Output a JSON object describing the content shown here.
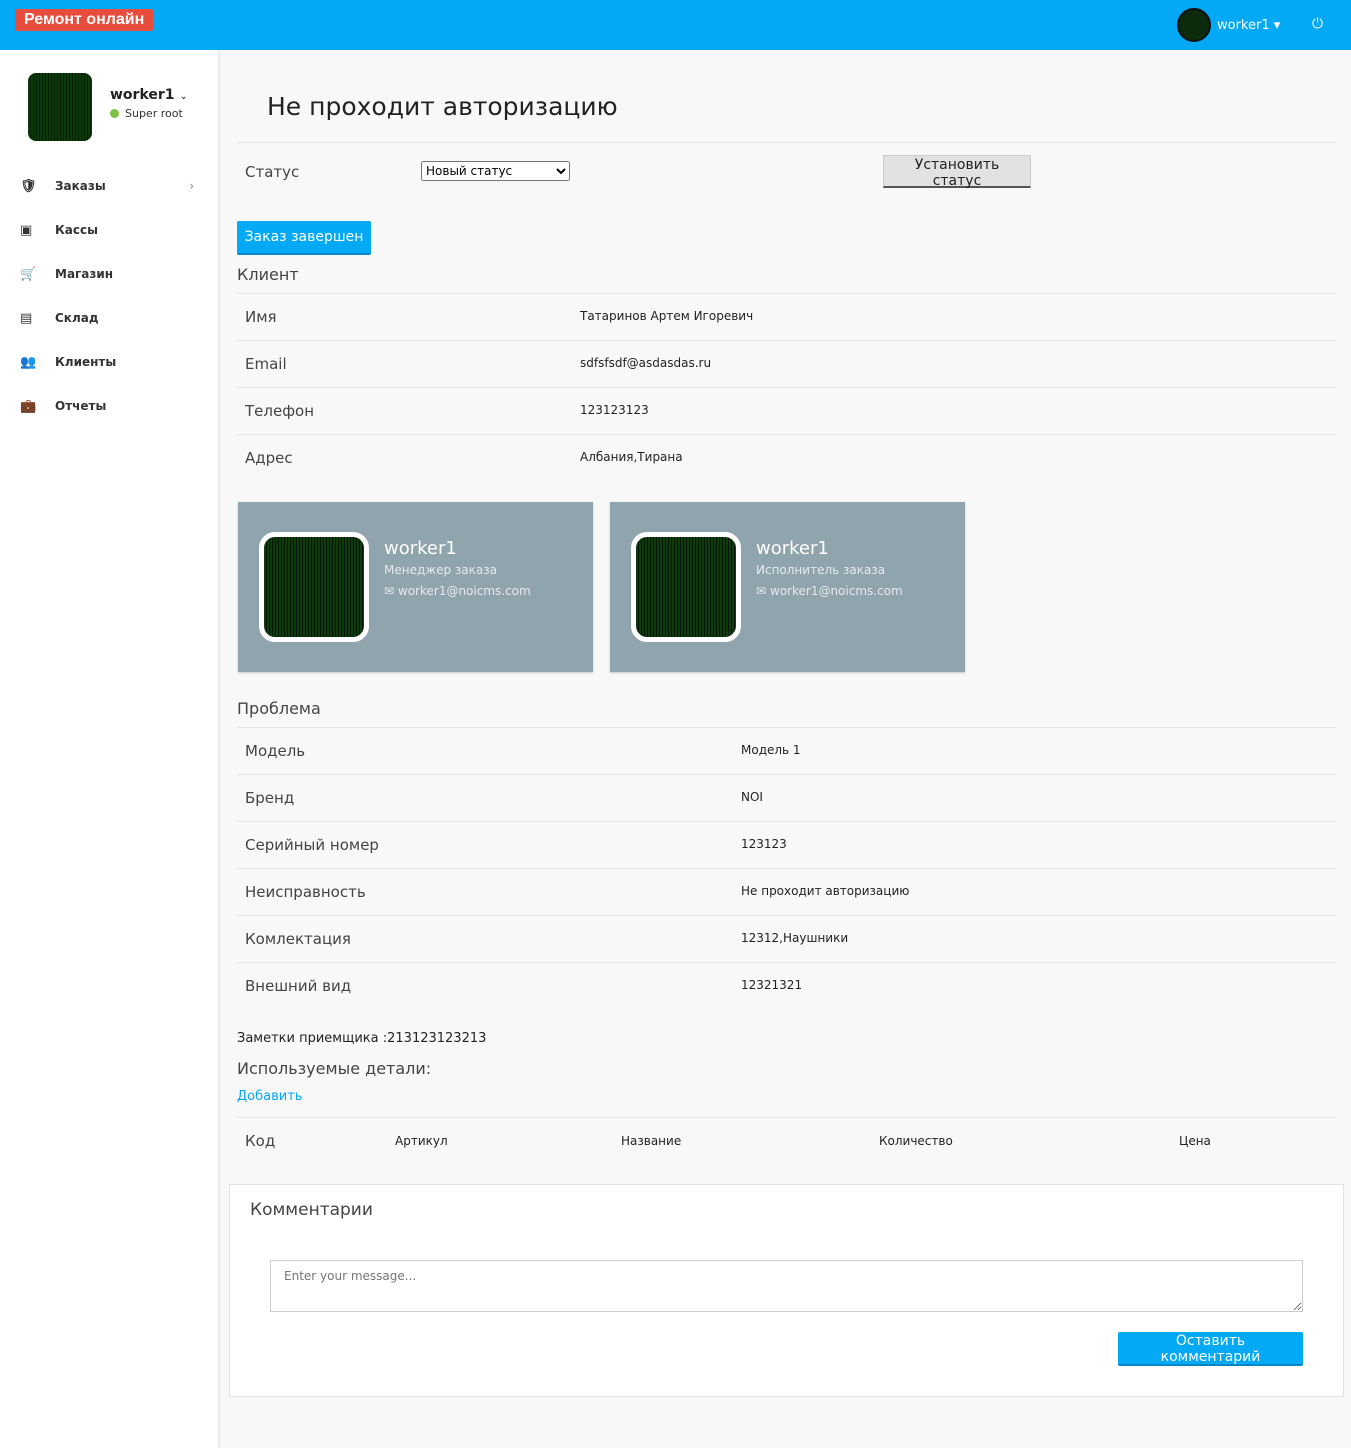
{
  "brand": "Ремонт онлайн",
  "topbar": {
    "username": "worker1"
  },
  "sidebar": {
    "username": "worker1",
    "role": "Super root",
    "items": [
      {
        "label": "Заказы",
        "icon": "orders-icon"
      },
      {
        "label": "Кассы",
        "icon": "money-icon"
      },
      {
        "label": "Магазин",
        "icon": "cart-icon"
      },
      {
        "label": "Склад",
        "icon": "files-icon"
      },
      {
        "label": "Клиенты",
        "icon": "users-icon"
      },
      {
        "label": "Отчеты",
        "icon": "briefcase-icon"
      }
    ]
  },
  "page": {
    "title": "Не проходит авторизацию",
    "status_label": "Статус",
    "status_value": "Новый статус",
    "set_status": "Установить статус",
    "complete": "Заказ завершен"
  },
  "client": {
    "title": "Клиент",
    "rows": [
      {
        "label": "Имя",
        "value": "Татаринов Артем Игоревич"
      },
      {
        "label": "Email",
        "value": "sdfsfsdf@asdasdas.ru"
      },
      {
        "label": "Телефон",
        "value": "123123123"
      },
      {
        "label": "Адрес",
        "value": "Албания,Тирана"
      }
    ]
  },
  "cards": [
    {
      "name": "worker1",
      "role": "Менеджер заказа",
      "email": "worker1@noicms.com"
    },
    {
      "name": "worker1",
      "role": "Исполнитель заказа",
      "email": "worker1@noicms.com"
    }
  ],
  "problem": {
    "title": "Проблема",
    "rows": [
      {
        "label": "Модель",
        "value": "Модель 1"
      },
      {
        "label": "Бренд",
        "value": "NOI"
      },
      {
        "label": "Серийный номер",
        "value": "123123"
      },
      {
        "label": "Неисправность",
        "value": "Не проходит авторизацию"
      },
      {
        "label": "Комлектация",
        "value": "12312,Наушники"
      },
      {
        "label": "Внешний вид",
        "value": "12321321"
      }
    ]
  },
  "notes": "Заметки приемщика :213123123213",
  "parts": {
    "title": "Используемые детали:",
    "add": "Добавить",
    "columns": [
      "Код",
      "Артикул",
      "Название",
      "Количество",
      "Цена"
    ]
  },
  "comments": {
    "title": "Комментарии",
    "placeholder": "Enter your message...",
    "submit": "Оставить комментарий"
  }
}
